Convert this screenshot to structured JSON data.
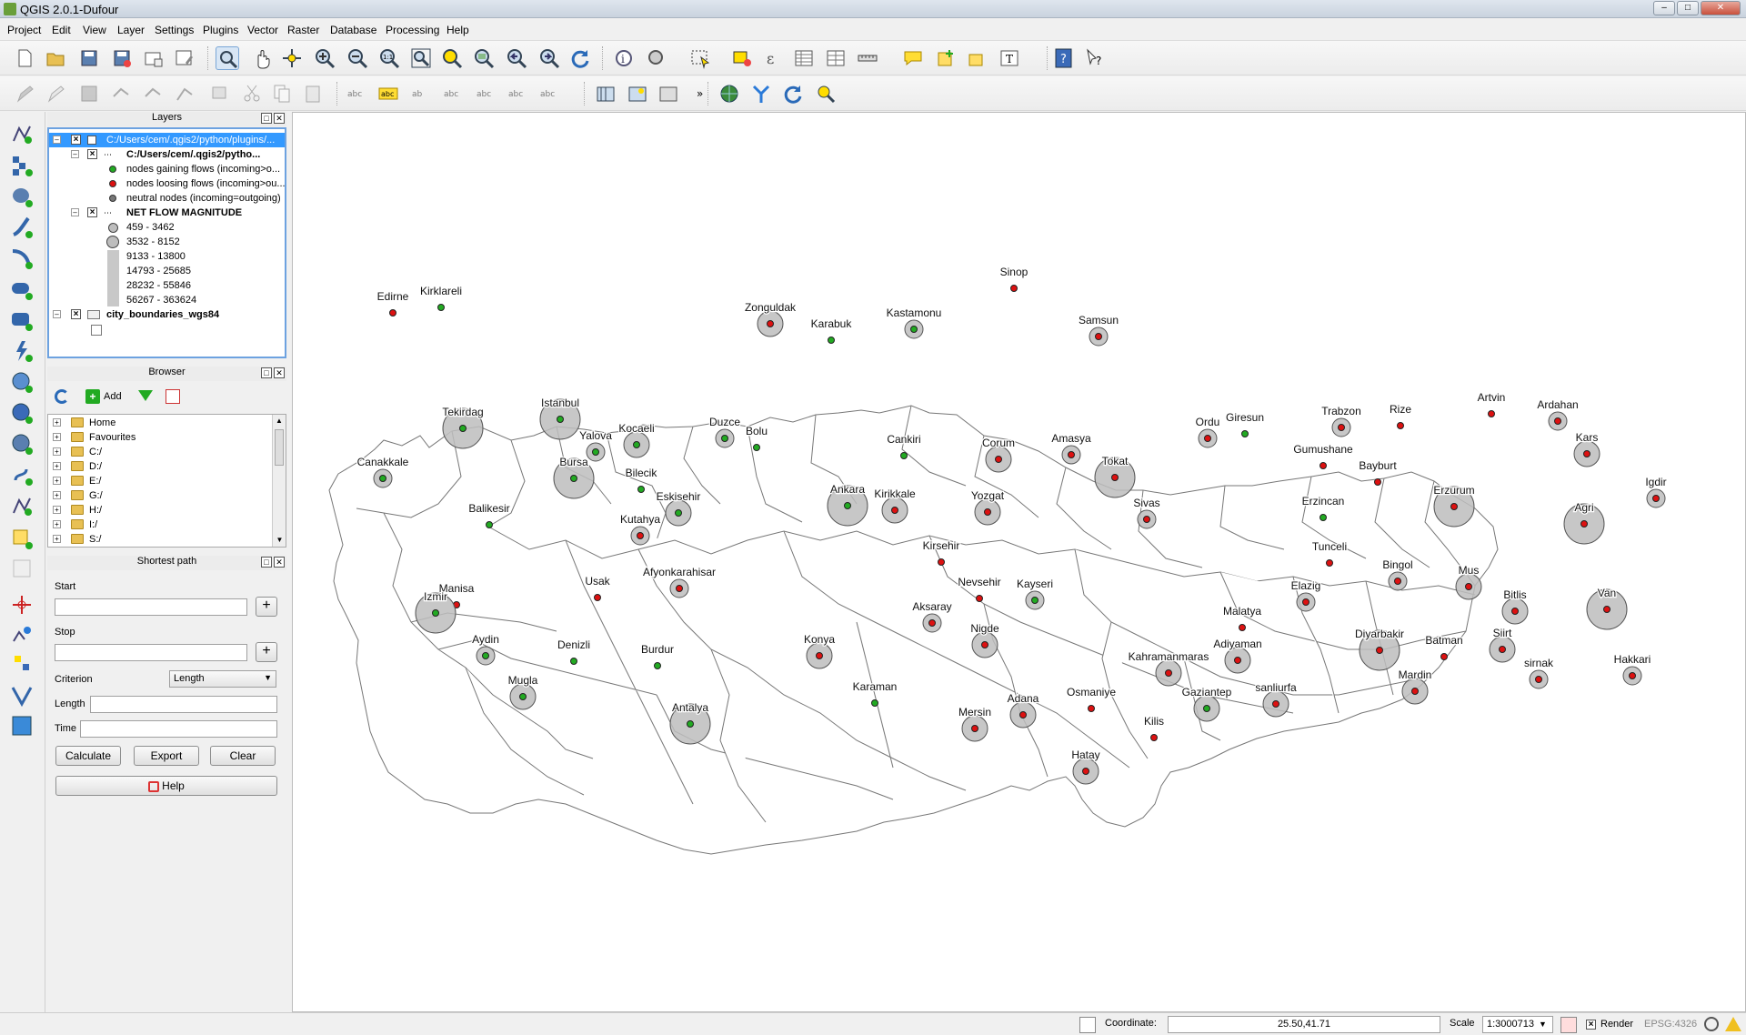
{
  "window": {
    "title": "QGIS 2.0.1-Dufour"
  },
  "menus": [
    "Project",
    "Edit",
    "View",
    "Layer",
    "Settings",
    "Plugins",
    "Vector",
    "Raster",
    "Database",
    "Processing",
    "Help"
  ],
  "layers_panel": {
    "title": "Layers",
    "items": [
      {
        "label": "C:/Users/cem/.qgis2/python/plugins/...",
        "level": 0,
        "bold": false,
        "selected": true
      },
      {
        "label": "C:/Users/cem/.qgis2/pytho...",
        "level": 1,
        "bold": true
      },
      {
        "label": "nodes gaining flows (incoming>o...",
        "level": 2,
        "bold": false,
        "symbol": "dot",
        "color": "#22aa22"
      },
      {
        "label": "nodes loosing flows (incoming>ou...",
        "level": 2,
        "bold": false,
        "symbol": "dot",
        "color": "#dd1111"
      },
      {
        "label": "neutral nodes (incoming=outgoing)",
        "level": 2,
        "bold": false,
        "symbol": "dot",
        "color": "#777777"
      },
      {
        "label": "NET FLOW MAGNITUDE",
        "level": 1,
        "bold": true
      },
      {
        "label": "459 - 3462",
        "level": 2,
        "bold": false,
        "symbol": "circle"
      },
      {
        "label": "3532 - 8152",
        "level": 2,
        "bold": false,
        "symbol": "circle"
      },
      {
        "label": "9133 - 13800",
        "level": 2,
        "bold": false,
        "symbol": "circle"
      },
      {
        "label": "14793 - 25685",
        "level": 2,
        "bold": false,
        "symbol": "circle"
      },
      {
        "label": "28232 - 55846",
        "level": 2,
        "bold": false,
        "symbol": "circle"
      },
      {
        "label": "56267 - 363624",
        "level": 2,
        "bold": false,
        "symbol": "circle"
      },
      {
        "label": "city_boundaries_wgs84",
        "level": 0,
        "bold": true
      }
    ]
  },
  "browser_panel": {
    "title": "Browser",
    "add_label": "Add",
    "items": [
      "Home",
      "Favourites",
      "C:/",
      "D:/",
      "E:/",
      "G:/",
      "H:/",
      "I:/",
      "S:/"
    ]
  },
  "shortest_path": {
    "title": "Shortest path",
    "start_label": "Start",
    "stop_label": "Stop",
    "criterion_label": "Criterion",
    "criterion_value": "Length",
    "length_label": "Length",
    "time_label": "Time",
    "calculate": "Calculate",
    "export": "Export",
    "clear": "Clear",
    "help": "Help"
  },
  "statusbar": {
    "coordinate_label": "Coordinate:",
    "coordinate_value": "25.50,41.71",
    "scale_label": "Scale",
    "scale_value": "1:3000713",
    "render_label": "Render",
    "crs": "EPSG:4326"
  },
  "map": {
    "colors": {
      "gain": "#22aa22",
      "loss": "#dd1111",
      "circle": "#bdbdbd"
    },
    "cities": [
      {
        "name": "Sinop",
        "type": "loss",
        "mag": 1
      },
      {
        "name": "Edirne",
        "type": "loss",
        "mag": 1
      },
      {
        "name": "Kirklareli",
        "type": "gain",
        "mag": 1
      },
      {
        "name": "Zonguldak",
        "type": "loss",
        "mag": 3
      },
      {
        "name": "Kastamonu",
        "type": "gain",
        "mag": 2
      },
      {
        "name": "Karabuk",
        "type": "gain",
        "mag": 1
      },
      {
        "name": "Samsun",
        "type": "loss",
        "mag": 2
      },
      {
        "name": "Tekirdag",
        "type": "gain",
        "mag": 4
      },
      {
        "name": "Istanbul",
        "type": "gain",
        "mag": 4
      },
      {
        "name": "Kocaeli",
        "type": "gain",
        "mag": 3
      },
      {
        "name": "Yalova",
        "type": "gain",
        "mag": 2
      },
      {
        "name": "Duzce",
        "type": "gain",
        "mag": 2
      },
      {
        "name": "Bolu",
        "type": "gain",
        "mag": 1
      },
      {
        "name": "Cankiri",
        "type": "gain",
        "mag": 1
      },
      {
        "name": "Corum",
        "type": "loss",
        "mag": 3
      },
      {
        "name": "Amasya",
        "type": "loss",
        "mag": 2
      },
      {
        "name": "Ordu",
        "type": "loss",
        "mag": 2
      },
      {
        "name": "Giresun",
        "type": "gain",
        "mag": 1
      },
      {
        "name": "Trabzon",
        "type": "loss",
        "mag": 2
      },
      {
        "name": "Rize",
        "type": "loss",
        "mag": 1
      },
      {
        "name": "Artvin",
        "type": "loss",
        "mag": 1
      },
      {
        "name": "Ardahan",
        "type": "loss",
        "mag": 2
      },
      {
        "name": "Kars",
        "type": "loss",
        "mag": 3
      },
      {
        "name": "Igdir",
        "type": "loss",
        "mag": 2
      },
      {
        "name": "Canakkale",
        "type": "gain",
        "mag": 2
      },
      {
        "name": "Bursa",
        "type": "gain",
        "mag": 4
      },
      {
        "name": "Bilecik",
        "type": "gain",
        "mag": 1
      },
      {
        "name": "Balikesir",
        "type": "gain",
        "mag": 1
      },
      {
        "name": "Eskisehir",
        "type": "gain",
        "mag": 3
      },
      {
        "name": "Ankara",
        "type": "gain",
        "mag": 4
      },
      {
        "name": "Kirikkale",
        "type": "loss",
        "mag": 3
      },
      {
        "name": "Yozgat",
        "type": "loss",
        "mag": 3
      },
      {
        "name": "Tokat",
        "type": "loss",
        "mag": 4
      },
      {
        "name": "Sivas",
        "type": "loss",
        "mag": 2
      },
      {
        "name": "Gumushane",
        "type": "loss",
        "mag": 1
      },
      {
        "name": "Bayburt",
        "type": "loss",
        "mag": 1
      },
      {
        "name": "Erzincan",
        "type": "gain",
        "mag": 1
      },
      {
        "name": "Erzurum",
        "type": "loss",
        "mag": 4
      },
      {
        "name": "Agri",
        "type": "loss",
        "mag": 4
      },
      {
        "name": "Kutahya",
        "type": "loss",
        "mag": 2
      },
      {
        "name": "Kirsehir",
        "type": "loss",
        "mag": 1
      },
      {
        "name": "Tunceli",
        "type": "loss",
        "mag": 1
      },
      {
        "name": "Manisa",
        "type": "loss",
        "mag": 1
      },
      {
        "name": "Usak",
        "type": "loss",
        "mag": 1
      },
      {
        "name": "Afyonkarahisar",
        "type": "loss",
        "mag": 2
      },
      {
        "name": "Nevsehir",
        "type": "loss",
        "mag": 1
      },
      {
        "name": "Kayseri",
        "type": "gain",
        "mag": 2
      },
      {
        "name": "Elazig",
        "type": "loss",
        "mag": 2
      },
      {
        "name": "Bingol",
        "type": "loss",
        "mag": 2
      },
      {
        "name": "Mus",
        "type": "loss",
        "mag": 3
      },
      {
        "name": "Izmir",
        "type": "gain",
        "mag": 4
      },
      {
        "name": "Aksaray",
        "type": "loss",
        "mag": 2
      },
      {
        "name": "Malatya",
        "type": "loss",
        "mag": 1
      },
      {
        "name": "Bitlis",
        "type": "loss",
        "mag": 3
      },
      {
        "name": "Van",
        "type": "loss",
        "mag": 4
      },
      {
        "name": "Aydin",
        "type": "gain",
        "mag": 2
      },
      {
        "name": "Denizli",
        "type": "gain",
        "mag": 1
      },
      {
        "name": "Burdur",
        "type": "gain",
        "mag": 1
      },
      {
        "name": "Konya",
        "type": "loss",
        "mag": 3
      },
      {
        "name": "Nigde",
        "type": "loss",
        "mag": 3
      },
      {
        "name": "Kahramanmaras",
        "type": "loss",
        "mag": 3
      },
      {
        "name": "Adiyaman",
        "type": "loss",
        "mag": 3
      },
      {
        "name": "Diyarbakir",
        "type": "loss",
        "mag": 4
      },
      {
        "name": "Batman",
        "type": "loss",
        "mag": 1
      },
      {
        "name": "Siirt",
        "type": "loss",
        "mag": 3
      },
      {
        "name": "Hakkari",
        "type": "loss",
        "mag": 2
      },
      {
        "name": "sirnak",
        "type": "loss",
        "mag": 2
      },
      {
        "name": "Mugla",
        "type": "gain",
        "mag": 3
      },
      {
        "name": "Karaman",
        "type": "gain",
        "mag": 1
      },
      {
        "name": "Osmaniye",
        "type": "loss",
        "mag": 1
      },
      {
        "name": "Gaziantep",
        "type": "gain",
        "mag": 3
      },
      {
        "name": "sanliurfa",
        "type": "loss",
        "mag": 3
      },
      {
        "name": "Mardin",
        "type": "loss",
        "mag": 3
      },
      {
        "name": "Antalya",
        "type": "gain",
        "mag": 4
      },
      {
        "name": "Mersin",
        "type": "loss",
        "mag": 3
      },
      {
        "name": "Adana",
        "type": "loss",
        "mag": 3
      },
      {
        "name": "Kilis",
        "type": "loss",
        "mag": 1
      },
      {
        "name": "Hatay",
        "type": "loss",
        "mag": 3
      }
    ]
  }
}
